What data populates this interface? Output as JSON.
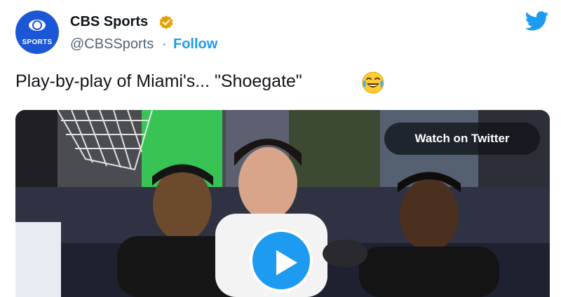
{
  "account": {
    "name": "CBS Sports",
    "handle": "@CBSSports",
    "separator": "·",
    "follow_label": "Follow",
    "avatar_text": "SPORTS",
    "verified_badge_color": "#e8a000",
    "avatar_color": "#1a56d6"
  },
  "tweet": {
    "text": "Play-by-play of Miami's... \"Shoegate\"",
    "emoji": "face-with-tears-of-joy"
  },
  "media": {
    "watch_label": "Watch on Twitter",
    "play_icon": "play-icon"
  },
  "brand": {
    "logo_icon": "twitter-bird-icon",
    "accent": "#1d9bf0"
  }
}
